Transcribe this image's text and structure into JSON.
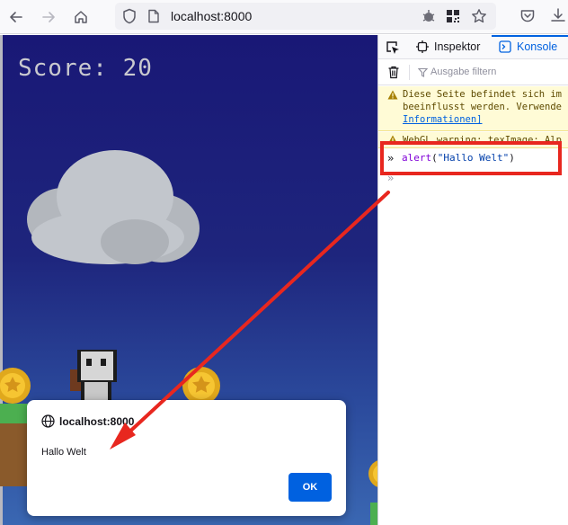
{
  "browser": {
    "url": "localhost:8000",
    "nav_icons": [
      "back-arrow-icon",
      "forward-arrow-icon",
      "home-icon"
    ],
    "url_icons": [
      "shield-icon",
      "page-icon"
    ],
    "right_icons": [
      "extension-icon",
      "qr-code-icon",
      "star-icon",
      "pocket-icon",
      "download-icon"
    ]
  },
  "game": {
    "score_text": "Score: 20"
  },
  "devtools": {
    "tab_inspector": "Inspektor",
    "tab_console": "Konsole",
    "filter_placeholder": "Ausgabe filtern",
    "warnings": [
      {
        "lines": [
          "Diese Seite befindet sich im",
          "beeinflusst werden. Verwende"
        ],
        "link": "Informationen]"
      },
      {
        "lines": [
          "WebGL warning: texImage: Alp"
        ]
      }
    ],
    "command": {
      "fn": "alert",
      "open": "(",
      "arg": "\"Hallo Welt\"",
      "close": ")"
    },
    "accent_color": "#0061e0"
  },
  "alert": {
    "origin": "localhost:8000",
    "message": "Hallo Welt",
    "ok_label": "OK"
  },
  "annotation": {
    "color": "#e8271f"
  }
}
